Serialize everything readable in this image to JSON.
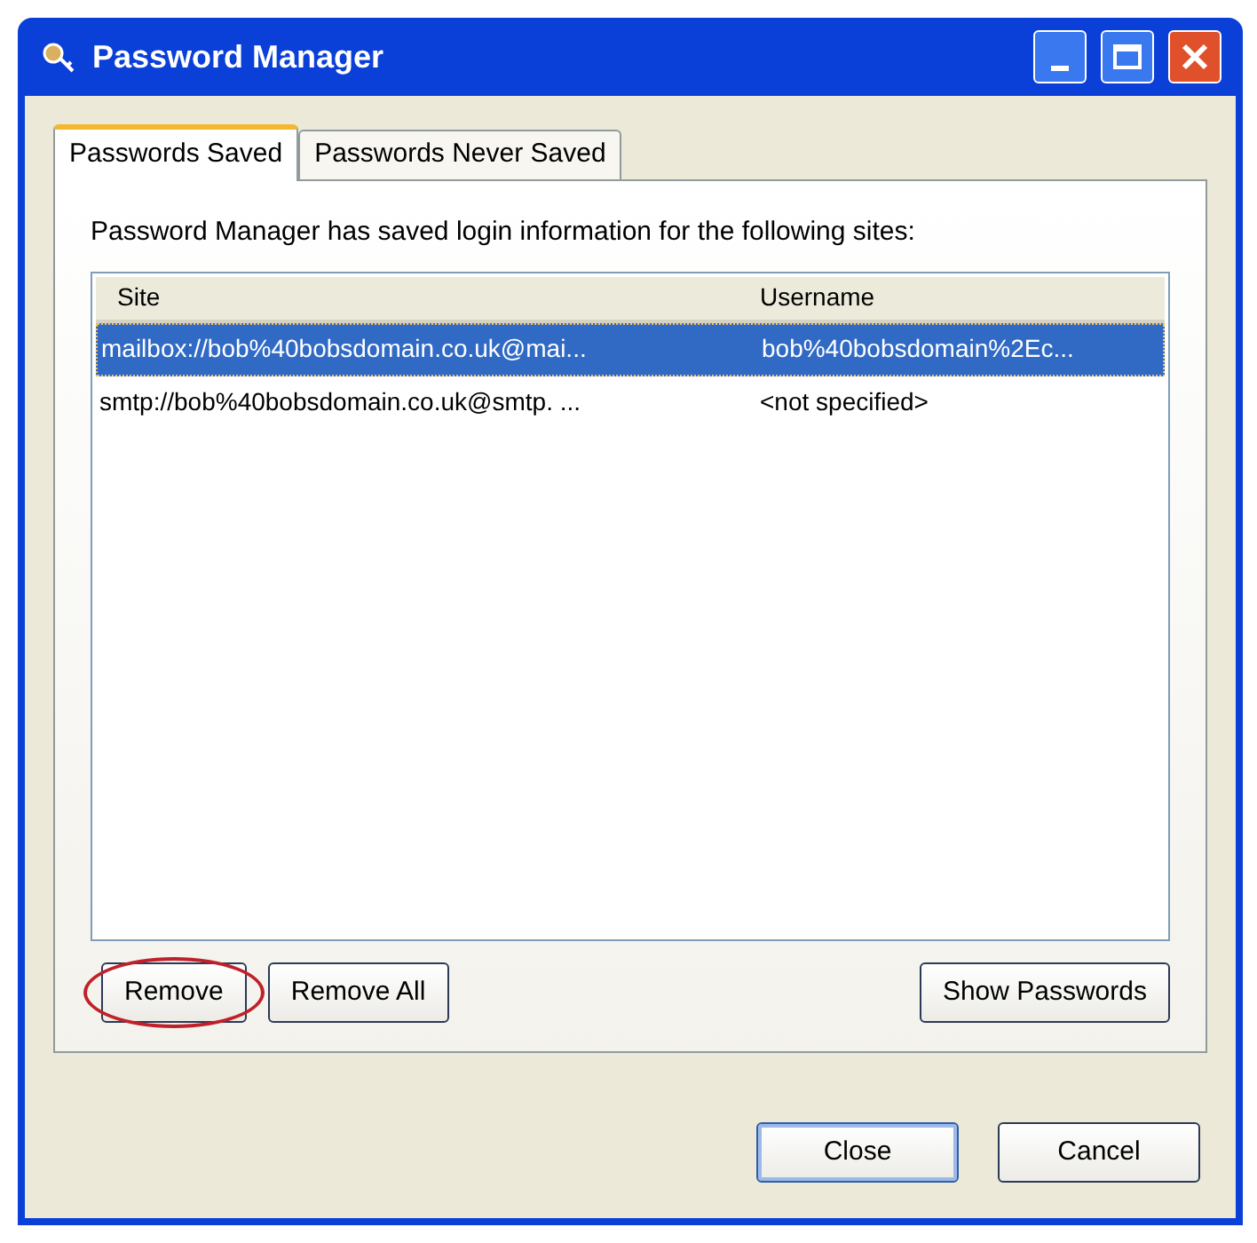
{
  "window": {
    "title": "Password Manager"
  },
  "tabs": [
    {
      "label": "Passwords Saved",
      "selected": true
    },
    {
      "label": "Passwords Never Saved",
      "selected": false
    }
  ],
  "intro": "Password Manager has saved login information for the following sites:",
  "table": {
    "columns": [
      "Site",
      "Username"
    ],
    "rows": [
      {
        "site": "mailbox://bob%40bobsdomain.co.uk@mai...",
        "username": "bob%40bobsdomain%2Ec...",
        "selected": true
      },
      {
        "site": "smtp://bob%40bobsdomain.co.uk@smtp. ...",
        "username": "<not specified>",
        "selected": false
      }
    ]
  },
  "list_buttons": [
    {
      "label": "Remove",
      "highlighted": true
    },
    {
      "label": "Remove All",
      "highlighted": false
    },
    {
      "label": "Show Passwords",
      "highlighted": false
    }
  ],
  "dialog_buttons": [
    {
      "label": "Close",
      "default": true
    },
    {
      "label": "Cancel",
      "default": false
    }
  ]
}
